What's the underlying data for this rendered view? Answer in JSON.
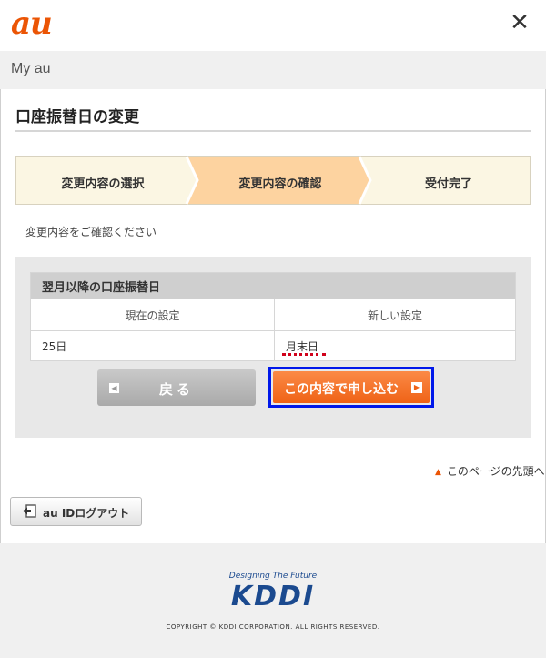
{
  "header": {
    "logo": "au",
    "close_icon": "close-icon",
    "close_glyph": "✕"
  },
  "subheader": {
    "title": "My au"
  },
  "page": {
    "title": "口座振替日の変更"
  },
  "steps": [
    {
      "label": "変更内容の選択",
      "state": "done"
    },
    {
      "label": "変更内容の確認",
      "state": "current"
    },
    {
      "label": "受付完了",
      "state": "todo"
    }
  ],
  "note": "変更内容をご確認ください",
  "table": {
    "caption": "翌月以降の口座振替日",
    "headers": [
      "現在の設定",
      "新しい設定"
    ],
    "current_value": "25日",
    "new_value": "月末日"
  },
  "buttons": {
    "back": {
      "label": "戻る",
      "icon": "arrow-left-icon",
      "glyph": "◀"
    },
    "submit": {
      "label": "この内容で申し込む",
      "icon": "arrow-right-icon",
      "glyph": "▶"
    }
  },
  "page_top_link": "このページの先頭へ",
  "logout": {
    "label": "au IDログアウト",
    "icon": "logout-icon"
  },
  "footer": {
    "tagline": "Designing The Future",
    "brand": "KDDI",
    "copyright": "COPYRIGHT © KDDI CORPORATION. ALL RIGHTS RESERVED."
  },
  "colors": {
    "accent": "#eb5505",
    "step_current": "#fdd3a0",
    "step_other": "#fbf6e3",
    "focus": "#0018ea",
    "submit": "#f47a33"
  }
}
